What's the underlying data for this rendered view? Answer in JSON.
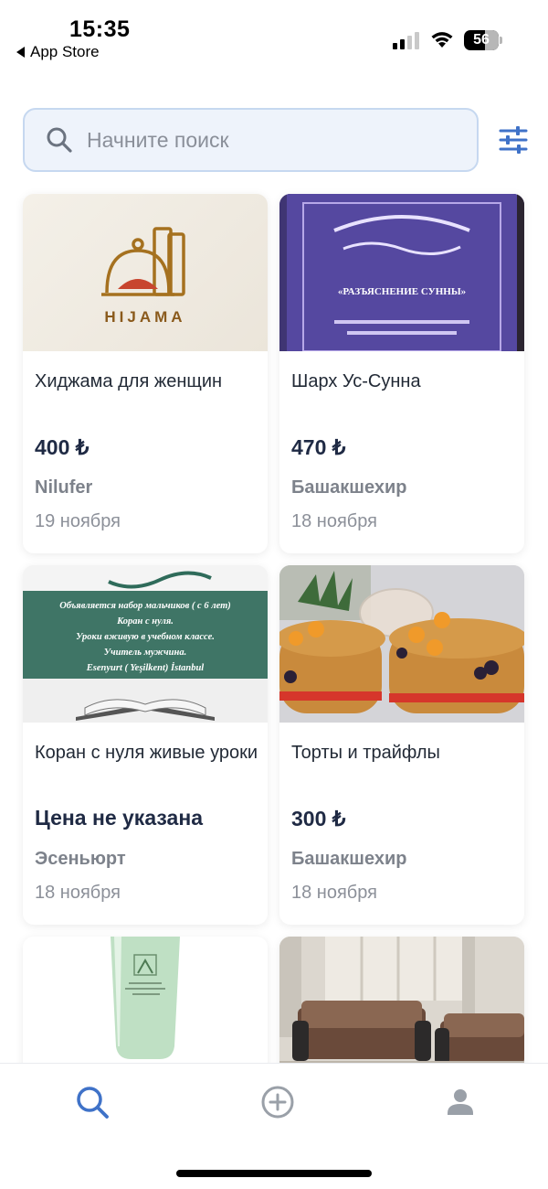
{
  "status_bar": {
    "time": "15:35",
    "back_label": "App Store",
    "battery": "56"
  },
  "search": {
    "placeholder": "Начните поиск"
  },
  "listings": [
    {
      "title": "Хиджама для женщин",
      "price": "400 ₺",
      "location": "Nilufer",
      "date": "19 ноября",
      "image_text": "HIJAMA"
    },
    {
      "title": "Шарх Ус-Сунна",
      "price": "470 ₺",
      "location": "Башакшехир",
      "date": "18 ноября",
      "image_text": "«РАЗЪЯСНЕНИЕ СУННЫ»"
    },
    {
      "title": "Коран с нуля живые уроки",
      "price": "Цена не указана",
      "location": "Эсеньюрт",
      "date": "18 ноября",
      "image_lines": [
        "Объявляется набор мальчиков ( с 6 лет)",
        "Коран с нуля.",
        "Уроки вживую в учебном классе.",
        "Учитель мужчина.",
        "Esenyurt ( Yeşilkent) İstanbul"
      ]
    },
    {
      "title": "Торты и трайфлы",
      "price": "300 ₺",
      "location": "Башакшехир",
      "date": "18 ноября"
    },
    {
      "title": "",
      "image": "cosmetic-tube"
    },
    {
      "title": "",
      "image": "sofa-set"
    }
  ],
  "nav": {
    "items": [
      "search-icon",
      "add-circle-icon",
      "profile-icon"
    ],
    "accent_color": "#3f72c8",
    "inactive_color": "#9aa0a8"
  }
}
